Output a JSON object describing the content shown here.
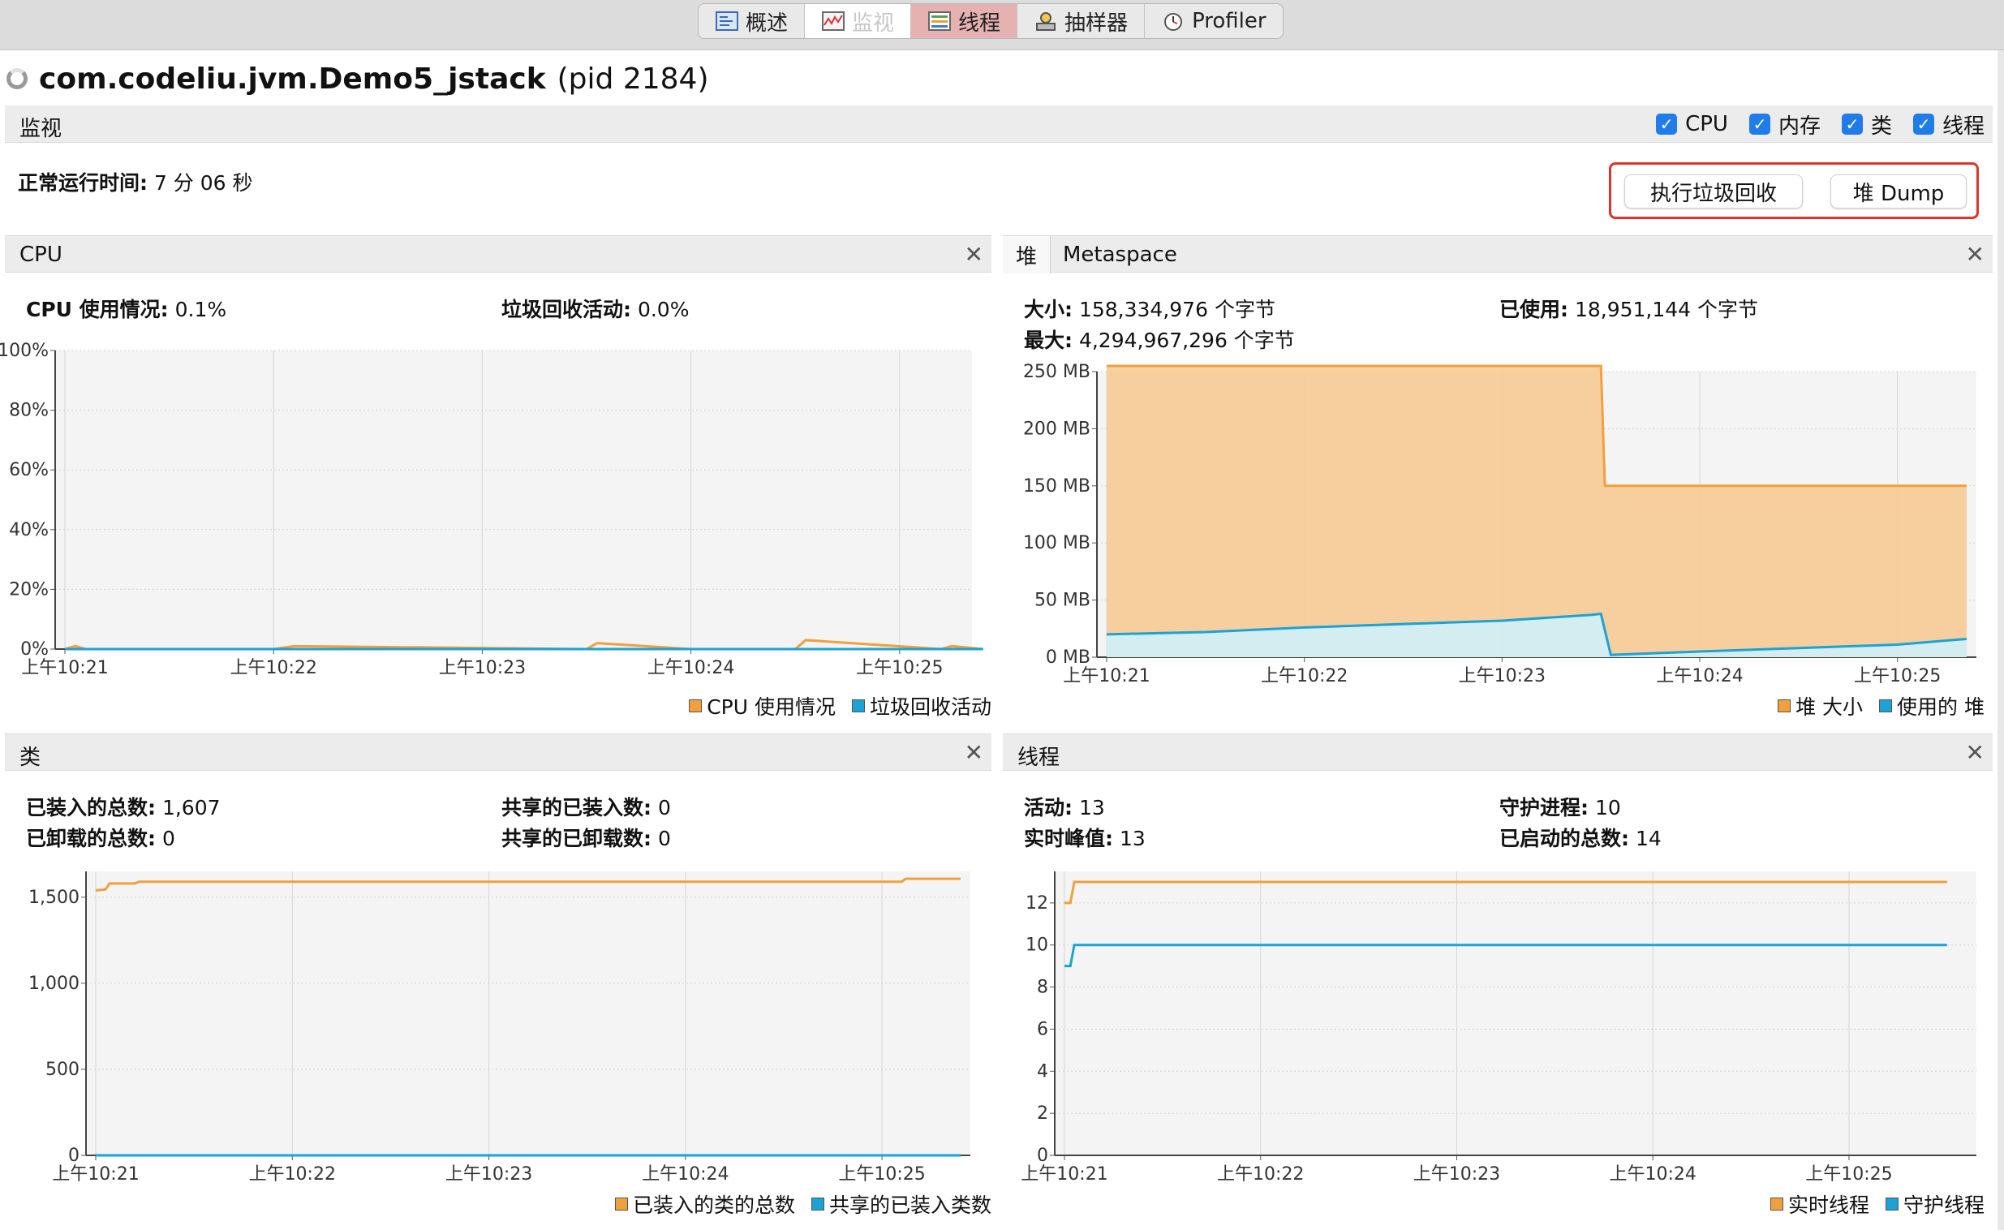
{
  "toolbar": {
    "tabs": [
      {
        "label": "概述",
        "icon": "overview-icon"
      },
      {
        "label": "监视",
        "icon": "monitor-icon"
      },
      {
        "label": "线程",
        "icon": "threads-icon"
      },
      {
        "label": "抽样器",
        "icon": "sampler-icon"
      },
      {
        "label": "Profiler",
        "icon": "profiler-icon"
      }
    ]
  },
  "header": {
    "app_name": "com.codeliu.jvm.Demo5_jstack",
    "pid": "(pid 2184)"
  },
  "monitor": {
    "label": "监视",
    "checkboxes": [
      "CPU",
      "内存",
      "类",
      "线程"
    ],
    "uptime_label": "正常运行时间:",
    "uptime_value": "7 分 06 秒",
    "gc_button": "执行垃圾回收",
    "dump_button": "堆 Dump"
  },
  "colors": {
    "orange": "#f0a03c",
    "blue": "#1ba3d6",
    "orange_fill": "#f7cb96",
    "blue_fill": "#cfeff8"
  },
  "panels": {
    "cpu": {
      "title": "CPU",
      "usage_label": "CPU 使用情况:",
      "usage_value": "0.1%",
      "gc_label": "垃圾回收活动:",
      "gc_value": "0.0%",
      "legend": [
        "CPU 使用情况",
        "垃圾回收活动"
      ]
    },
    "heap": {
      "tab_heap": "堆",
      "tab_meta": "Metaspace",
      "size_label": "大小:",
      "size_value": "158,334,976 个字节",
      "used_label": "已使用:",
      "used_value": "18,951,144 个字节",
      "max_label": "最大:",
      "max_value": "4,294,967,296 个字节",
      "legend": [
        "堆 大小",
        "使用的 堆"
      ]
    },
    "classes": {
      "title": "类",
      "loaded_label": "已装入的总数:",
      "loaded_value": "1,607",
      "shared_loaded_label": "共享的已装入数:",
      "shared_loaded_value": "0",
      "unloaded_label": "已卸载的总数:",
      "unloaded_value": "0",
      "shared_unloaded_label": "共享的已卸载数:",
      "shared_unloaded_value": "0",
      "legend": [
        "已装入的类的总数",
        "共享的已装入类数"
      ]
    },
    "threads": {
      "title": "线程",
      "live_label": "活动:",
      "live_value": "13",
      "daemon_label": "守护进程:",
      "daemon_value": "10",
      "peak_label": "实时峰值:",
      "peak_value": "13",
      "started_label": "已启动的总数:",
      "started_value": "14",
      "legend": [
        "实时线程",
        "守护线程"
      ]
    }
  },
  "chart_data": [
    {
      "type": "line",
      "x_ticks": [
        "上午10:21",
        "上午10:22",
        "上午10:23",
        "上午10:24",
        "上午10:25"
      ],
      "y_ticks": [
        "100%",
        "80%",
        "60%",
        "40%",
        "20%",
        "0%"
      ],
      "ylim": [
        0,
        100
      ],
      "series": [
        {
          "name": "CPU 使用情况",
          "x": [
            0,
            0.05,
            0.1,
            1.0,
            1.1,
            2.5,
            2.55,
            3.0,
            3.5,
            3.55,
            4.2,
            4.25,
            4.4
          ],
          "values": [
            0,
            1,
            0,
            0,
            1,
            0,
            2,
            0,
            0,
            3,
            0,
            1,
            0
          ]
        },
        {
          "name": "垃圾回收活动",
          "x": [
            0,
            4.4
          ],
          "values": [
            0,
            0
          ]
        }
      ]
    },
    {
      "type": "area",
      "x_ticks": [
        "上午10:21",
        "上午10:22",
        "上午10:23",
        "上午10:24",
        "上午10:25"
      ],
      "y_ticks": [
        "250 MB",
        "200 MB",
        "150 MB",
        "100 MB",
        "50 MB",
        "0 MB"
      ],
      "ylim": [
        0,
        250
      ],
      "series": [
        {
          "name": "堆 大小",
          "x": [
            0,
            2.5,
            2.52,
            4.35
          ],
          "values": [
            255,
            255,
            150,
            150
          ]
        },
        {
          "name": "使用的 堆",
          "x": [
            0,
            0.5,
            1.0,
            1.5,
            2.0,
            2.45,
            2.5,
            2.55,
            3.0,
            3.5,
            4.0,
            4.35
          ],
          "values": [
            20,
            22,
            26,
            29,
            32,
            37,
            38,
            2,
            5,
            8,
            11,
            16
          ]
        }
      ]
    },
    {
      "type": "line",
      "x_ticks": [
        "上午10:21",
        "上午10:22",
        "上午10:23",
        "上午10:24",
        "上午10:25"
      ],
      "y_ticks": [
        "1,500",
        "1,000",
        "500",
        "0"
      ],
      "ylim": [
        0,
        1650
      ],
      "series": [
        {
          "name": "已装入的类的总数",
          "x": [
            0,
            0.05,
            0.07,
            0.2,
            0.22,
            4.1,
            4.12,
            4.4
          ],
          "values": [
            1540,
            1545,
            1580,
            1580,
            1590,
            1590,
            1607,
            1607
          ]
        },
        {
          "name": "共享的已装入类数",
          "x": [
            0,
            4.4
          ],
          "values": [
            0,
            0
          ]
        }
      ]
    },
    {
      "type": "line",
      "x_ticks": [
        "上午10:21",
        "上午10:22",
        "上午10:23",
        "上午10:24",
        "上午10:25"
      ],
      "y_ticks": [
        "12",
        "10",
        "8",
        "6",
        "4",
        "2",
        "0"
      ],
      "ylim": [
        0,
        13.5
      ],
      "series": [
        {
          "name": "实时线程",
          "x": [
            0,
            0.03,
            0.05,
            4.5
          ],
          "values": [
            12,
            12,
            13,
            13
          ]
        },
        {
          "name": "守护线程",
          "x": [
            0,
            0.03,
            0.05,
            4.5
          ],
          "values": [
            9,
            9,
            10,
            10
          ]
        }
      ]
    }
  ]
}
